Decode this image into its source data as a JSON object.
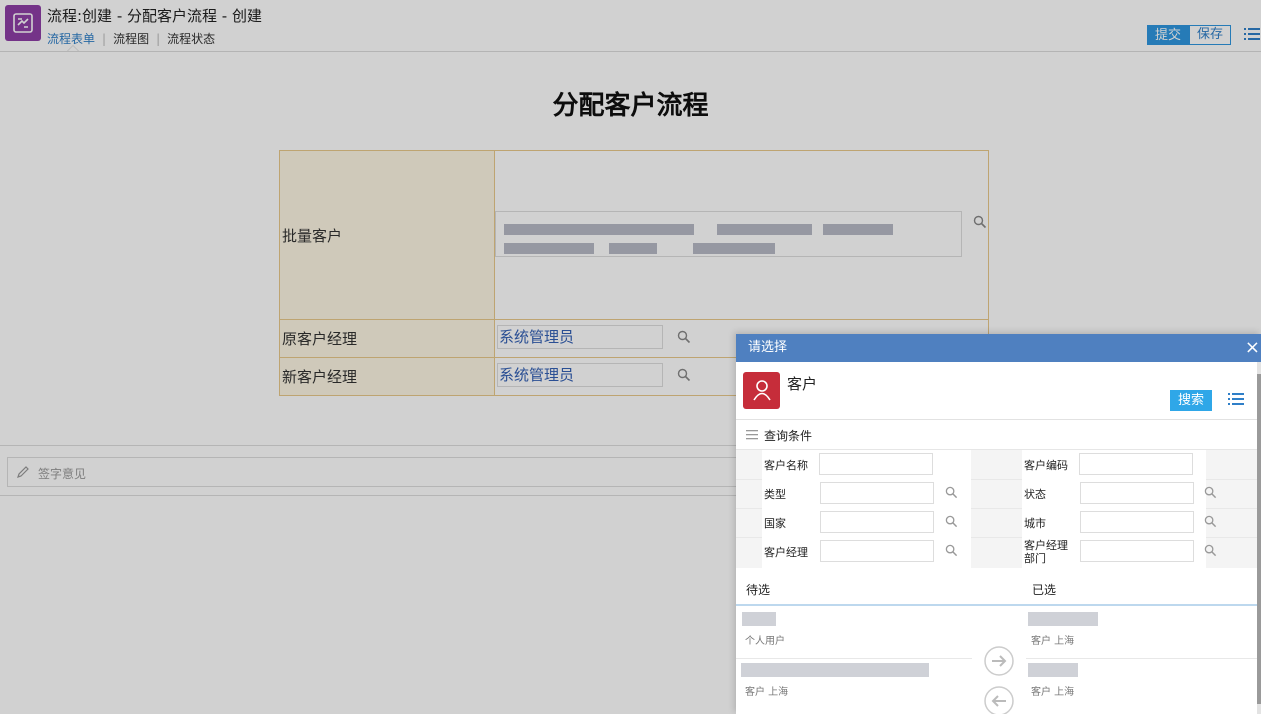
{
  "header": {
    "title": "流程:创建 - 分配客户流程 - 创建",
    "tabs": [
      "流程表单",
      "流程图",
      "流程状态"
    ],
    "submit_label": "提交",
    "save_label": "保存",
    "app_icon": "flow-icon",
    "menu_icon": "list-menu-icon"
  },
  "form": {
    "title": "分配客户流程",
    "rows": [
      {
        "label": "批量客户",
        "value": ""
      },
      {
        "label": "原客户经理",
        "value": "系统管理员"
      },
      {
        "label": "新客户经理",
        "value": "系统管理员"
      }
    ]
  },
  "opinion": {
    "placeholder": "签字意见",
    "icon": "pencil-icon"
  },
  "dialog": {
    "title": "请选择",
    "close": "×",
    "object_name": "客户",
    "object_icon": "user-icon",
    "search_label": "搜索",
    "query_conditions_label": "查询条件",
    "fields": [
      {
        "label": "客户名称"
      },
      {
        "label": "客户编码"
      },
      {
        "label": "类型"
      },
      {
        "label": "状态"
      },
      {
        "label": "国家"
      },
      {
        "label": "城市"
      },
      {
        "label": "客户经理"
      },
      {
        "label": "客户经理部门"
      }
    ],
    "pending_label": "待选",
    "selected_label": "已选",
    "pending_items": [
      {
        "sub": "个人用户"
      },
      {
        "sub": "客户  上海"
      }
    ],
    "selected_items": [
      {
        "sub": "客户  上海"
      },
      {
        "sub": "客户  上海"
      }
    ]
  },
  "colors": {
    "accent": "#2f97e0",
    "dialog_header": "#4f80c0",
    "label_bg": "#fdf6e3",
    "label_border": "#e8c98a",
    "app_icon": "#8e3fa6",
    "object_icon": "#c62d3a"
  }
}
